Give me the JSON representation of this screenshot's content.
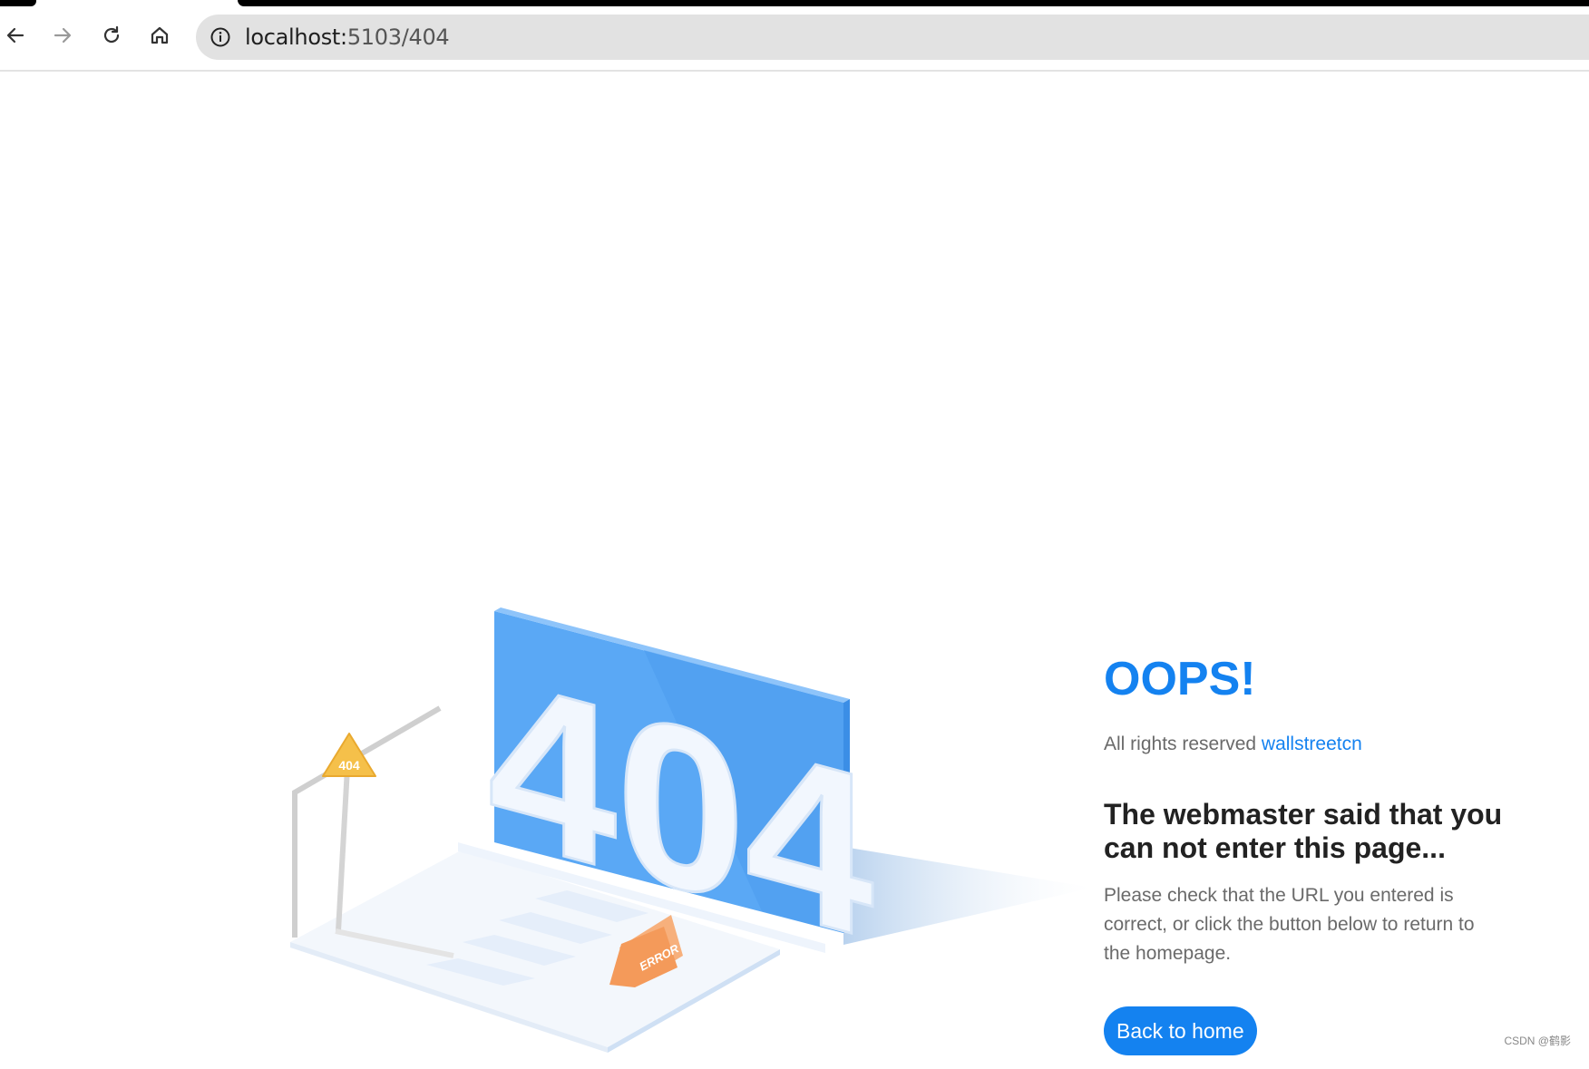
{
  "browser": {
    "url_host": "localhost:",
    "url_path": "5103/404",
    "icons": [
      "back-icon",
      "forward-icon",
      "reload-icon",
      "home-icon",
      "site-info-icon"
    ]
  },
  "illustration": {
    "big_text": "404",
    "sign_text": "404",
    "board_text": "ERROR"
  },
  "page": {
    "oops": "OOPS!",
    "info_prefix": "All rights reserved",
    "info_link": "wallstreetcn",
    "headline": "The webmaster said that you can not enter this page...",
    "detail": "Please check that the URL you entered is correct, or click the button below to return to the homepage.",
    "back_button": "Back to home"
  },
  "watermark": "CSDN @鹤影",
  "colors": {
    "accent": "#1482f0",
    "panel": "#5aa8f5",
    "sign": "#f5c04a",
    "board": "#f49a5a"
  }
}
